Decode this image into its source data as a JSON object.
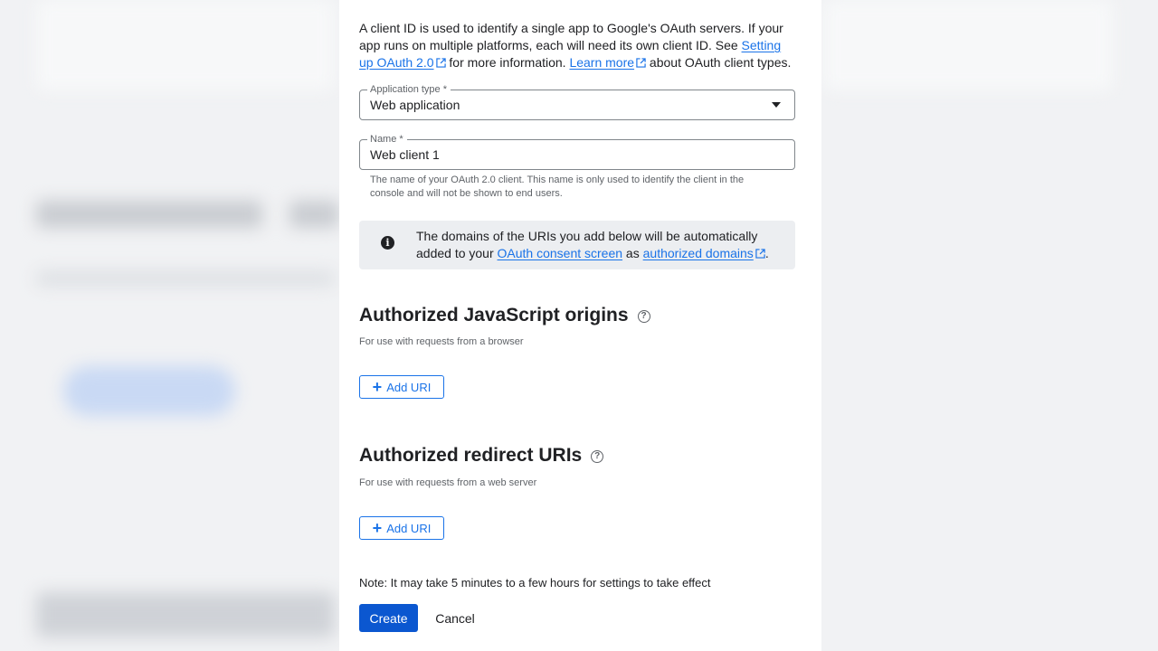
{
  "intro": {
    "text_1": "A client ID is used to identify a single app to Google's OAuth servers. If your app runs on multiple platforms, each will need its own client ID. See ",
    "link_1": "Setting up OAuth 2.0",
    "text_2": " for more information. ",
    "link_2": "Learn more",
    "text_3": " about OAuth client types."
  },
  "app_type": {
    "label": "Application type *",
    "value": "Web application"
  },
  "name_field": {
    "label": "Name *",
    "value": "Web client 1",
    "hint": "The name of your OAuth 2.0 client. This name is only used to identify the client in the console and will not be shown to end users."
  },
  "info_banner": {
    "text_1": "The domains of the URIs you add below will be automatically added to your ",
    "link_1": "OAuth consent screen",
    "text_2": " as ",
    "link_2": "authorized domains",
    "text_3": "."
  },
  "js_origins": {
    "title": "Authorized JavaScript origins",
    "subtitle": "For use with requests from a browser",
    "add_label": "Add URI"
  },
  "redirect_uris": {
    "title": "Authorized redirect URIs",
    "subtitle": "For use with requests from a web server",
    "add_label": "Add URI"
  },
  "footer": {
    "note": "Note: It may take 5 minutes to a few hours for settings to take effect",
    "create_label": "Create",
    "cancel_label": "Cancel"
  },
  "colors": {
    "link": "#1a73e8",
    "primary_button": "#0b57d0",
    "info_background": "#eceef1"
  },
  "icons": {
    "external_link": "open-in-new-icon",
    "dropdown": "caret-down-icon",
    "info": "info-icon",
    "help": "help-circle-icon",
    "add": "plus-icon"
  }
}
